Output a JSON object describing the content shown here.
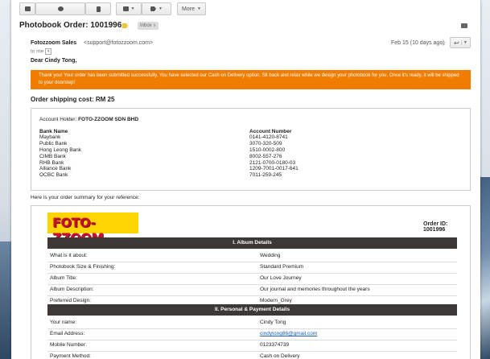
{
  "toolbar": {
    "more_label": "More"
  },
  "email": {
    "subject": "Photobook Order: 1001996",
    "inbox_tag": "Inbox",
    "inbox_tag_close": "x",
    "sender_name": "Fotozzoom Sales",
    "sender_email": "<support@fotozzoom.com>",
    "to_label": "to me",
    "date": "Feb 15 (10 days ago)",
    "greeting": "Dear Cindy Tong,",
    "notice": "Thank you! Your order has been submitted successfully. You have selected our Cash on Delivery option. Sit back and relax while we design your photobook for you. Once it's ready, it will be shipped to your doorstep!",
    "shipping_cost": "Order shipping cost: RM 25",
    "account_holder_label": "Account Holder:",
    "account_holder_value": "FOTO-ZZOOM SDN BHD",
    "bank_headers": [
      "Bank Name",
      "Account Number"
    ],
    "banks": [
      [
        "Maybank",
        "0141-4120-8741"
      ],
      [
        "Public Bank",
        "3070-320-509"
      ],
      [
        "Hong Leong Bank",
        "1510-0002-800"
      ],
      [
        "CIMB Bank",
        "8002-557-276"
      ],
      [
        "RHB Bank",
        "2121-0700-0180-03"
      ],
      [
        "Alliance Bank",
        "1209-7001-0017-641"
      ],
      [
        "OCBC Bank",
        "7011-259-245"
      ]
    ],
    "summary_intro": "Here is your order summary for your reference:",
    "logo_text": "FOTO-ZZOOM",
    "order_id": "Order ID: 1001996",
    "section1": "I. Album Details",
    "album_details": [
      [
        "What is it about:",
        "Wedding"
      ],
      [
        "Photobook Size & Finishing:",
        "Standard Premium"
      ],
      [
        "Album Title:",
        "Our Love Journey"
      ],
      [
        "Album Description:",
        "Our journal and memories throughout the years"
      ],
      [
        "Preferred Design:",
        "Modern_Grey"
      ]
    ],
    "section2": "II. Personal & Payment Details",
    "personal_details": [
      [
        "Your name:",
        "Cindy Tong"
      ],
      [
        "Email Address:",
        "cindytong86@gmail.com"
      ],
      [
        "Mobile Number:",
        "0123374739"
      ],
      [
        "Payment Method:",
        "Cash on Delivery"
      ]
    ]
  },
  "colors": {
    "notice_bg": "#f07d00",
    "section_bar": "#3c3835",
    "logo_bg": "#ffd400",
    "logo_text": "#c8102e"
  }
}
